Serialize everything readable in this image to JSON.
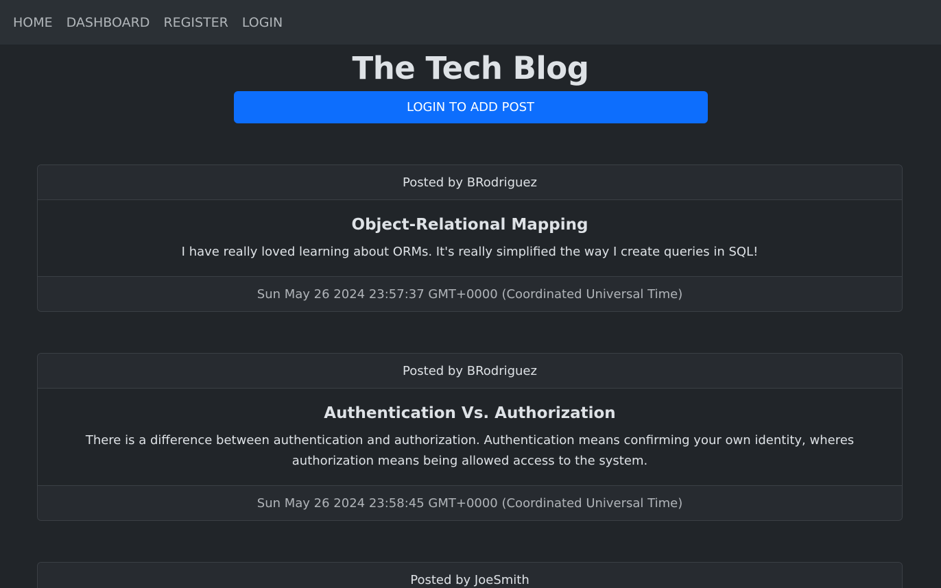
{
  "nav": {
    "items": [
      {
        "label": "HOME"
      },
      {
        "label": "DASHBOARD"
      },
      {
        "label": "REGISTER"
      },
      {
        "label": "LOGIN"
      }
    ]
  },
  "header": {
    "title": "The Tech Blog",
    "add_post_label": "LOGIN TO ADD POST"
  },
  "posts": [
    {
      "author_line": "Posted by BRodriguez",
      "title": "Object-Relational Mapping",
      "body": "I have really loved learning about ORMs. It's really simplified the way I create queries in SQL!",
      "date": "Sun May 26 2024 23:57:37 GMT+0000 (Coordinated Universal Time)"
    },
    {
      "author_line": "Posted by BRodriguez",
      "title": "Authentication Vs. Authorization",
      "body": "There is a difference between authentication and authorization. Authentication means confirming your own identity, wheres authorization means being allowed access to the system.",
      "date": "Sun May 26 2024 23:58:45 GMT+0000 (Coordinated Universal Time)"
    },
    {
      "author_line": "Posted by JoeSmith"
    }
  ],
  "colors": {
    "page_bg": "#212529",
    "navbar_bg": "#2b3035",
    "primary": "#0d6efd"
  }
}
